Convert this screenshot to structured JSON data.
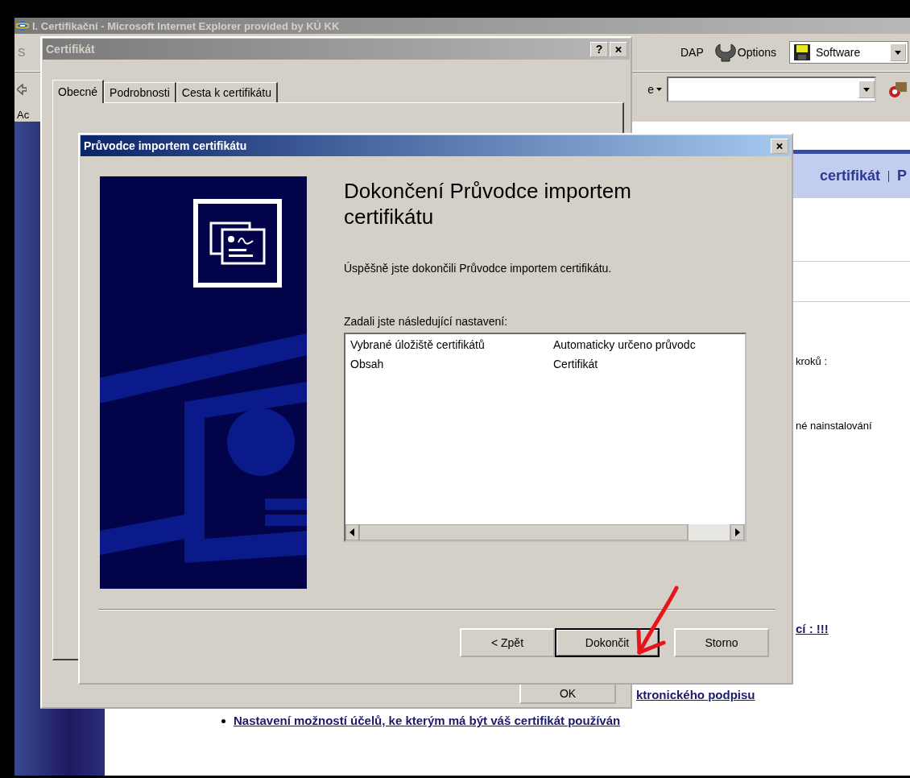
{
  "browser": {
    "title": "I. Certifikační - Microsoft Internet Explorer provided by KÚ KK",
    "active": false,
    "toolbar": [
      {
        "kind": "cut",
        "label": "S"
      },
      {
        "kind": "text",
        "label": "DAP"
      },
      {
        "kind": "wrench",
        "label": "Options"
      },
      {
        "kind": "dropdown",
        "label": "Software"
      }
    ],
    "search_provider": "e",
    "links_label": "Ac",
    "page": {
      "header": [
        "certifikát",
        "P"
      ],
      "lines": [
        {
          "kind": "text",
          "text": "kroků :"
        },
        {
          "kind": "text",
          "text": "né nainstalování"
        },
        {
          "kind": "link",
          "text": "cí :  !!!"
        },
        {
          "kind": "link",
          "text": "ktronického podpisu"
        },
        {
          "kind": "bullet-link",
          "text": "Nastavení možností účelů, ke kterým má být váš certifikát používán"
        }
      ]
    }
  },
  "certificate_dialog": {
    "title": "Certifikát",
    "active": false,
    "help": "?",
    "tabs": [
      {
        "label": "Obecné",
        "selected": true
      },
      {
        "label": "Podrobnosti",
        "selected": false
      },
      {
        "label": "Cesta k certifikátu",
        "selected": false
      }
    ],
    "ok_button": "OK"
  },
  "wizard": {
    "title": "Průvodce importem certifikátu",
    "active": true,
    "heading": "Dokončení Průvodce importem certifikátu",
    "message": "Úspěšně jste dokončili Průvodce importem certifikátu.",
    "settings_label": "Zadali jste následující nastavení:",
    "settings": [
      {
        "name": "Vybrané úložiště certifikátů",
        "value": "Automaticky určeno průvodc"
      },
      {
        "name": "Obsah",
        "value": "Certifikát"
      }
    ],
    "buttons": [
      {
        "label": "< Zpět",
        "default": false
      },
      {
        "label": "Dokončit",
        "default": true
      },
      {
        "label": "Storno",
        "default": false
      }
    ]
  }
}
